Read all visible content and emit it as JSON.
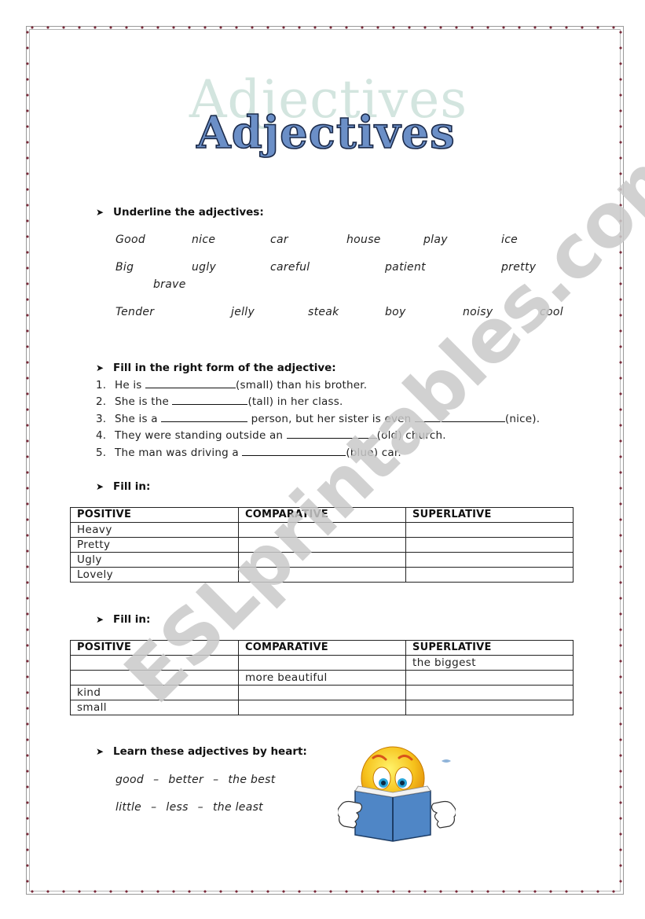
{
  "title": "Adjectives",
  "watermark": "ESLprintables.com",
  "section1": {
    "heading": "Underline the adjectives:",
    "rows": [
      [
        "Good",
        "nice",
        "car",
        "house",
        "play",
        "ice"
      ],
      [
        "Big",
        "ugly",
        "careful",
        "patient",
        "pretty"
      ],
      [
        "brave"
      ],
      [
        "Tender",
        "jelly",
        "steak",
        "boy",
        "noisy",
        "cool"
      ]
    ]
  },
  "section2": {
    "heading": "Fill in the right form of the adjective:",
    "items": [
      {
        "num": "1.",
        "before": "He is ",
        "after": "(small)  than his brother."
      },
      {
        "num": "2.",
        "before": "She is the ",
        "after": "(tall) in her class."
      },
      {
        "num": "3.",
        "before": "She is a ",
        "middle": " person, but her sister is even ",
        "after": "(nice)."
      },
      {
        "num": "4.",
        "before": "They were standing outside an ",
        "after": "(old) church."
      },
      {
        "num": "5.",
        "before": "The man was driving a ",
        "after": "(blue) car."
      }
    ]
  },
  "section3": {
    "heading": "Fill in:",
    "columns": [
      "POSITIVE",
      "COMPARATIVE",
      "SUPERLATIVE"
    ],
    "rows": [
      [
        "Heavy",
        "",
        ""
      ],
      [
        "Pretty",
        "",
        ""
      ],
      [
        "Ugly",
        "",
        ""
      ],
      [
        "Lovely",
        "",
        ""
      ]
    ]
  },
  "section4": {
    "heading": "Fill in:",
    "columns": [
      "POSITIVE",
      "COMPARATIVE",
      "SUPERLATIVE"
    ],
    "rows": [
      [
        "",
        "",
        "the biggest"
      ],
      [
        "",
        "more beautiful",
        ""
      ],
      [
        "kind",
        "",
        ""
      ],
      [
        "small",
        "",
        ""
      ]
    ]
  },
  "section5": {
    "heading": "Learn these adjectives by heart:",
    "lines": [
      [
        "good",
        "–",
        "better",
        "–",
        "the best"
      ],
      [
        "little",
        "–",
        "less",
        "–",
        "the least"
      ]
    ]
  },
  "icons": {
    "bullet": "arrowhead-bullet-icon",
    "illustration": "smiley-reading-book-icon"
  },
  "colors": {
    "title_fill": "#6b8fc7",
    "title_outline": "#1b2a4a",
    "title_shadow": "#cfe3dc",
    "watermark": "#c9c9c9",
    "border_dots": "#7a2a3a",
    "book_blue": "#4f86c6",
    "face_yellow": "#f6c21c"
  }
}
